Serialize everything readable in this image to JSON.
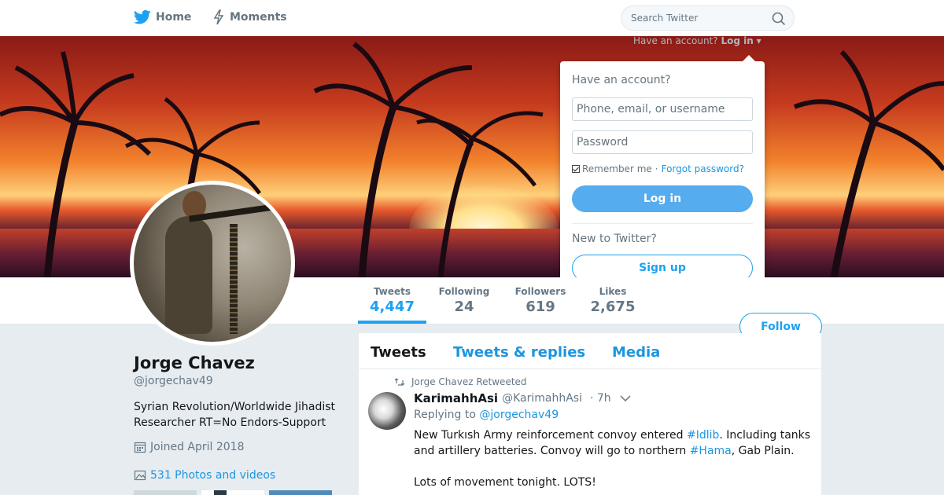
{
  "nav": {
    "home_label": "Home",
    "moments_label": "Moments",
    "search_placeholder": "Search Twitter",
    "signin_hint": "Have an account?",
    "signin_link": "Log in"
  },
  "login_dropdown": {
    "title": "Have an account?",
    "username_placeholder": "Phone, email, or username",
    "password_placeholder": "Password",
    "remember_label": "Remember me",
    "separator": "·",
    "forgot_label": "Forgot password?",
    "login_button": "Log in",
    "new_label": "New to Twitter?",
    "signup_button": "Sign up"
  },
  "stats": [
    {
      "label": "Tweets",
      "value": "4,447"
    },
    {
      "label": "Following",
      "value": "24"
    },
    {
      "label": "Followers",
      "value": "619"
    },
    {
      "label": "Likes",
      "value": "2,675"
    }
  ],
  "follow_button": "Follow",
  "profile": {
    "name": "Jorge Chavez",
    "handle": "@jorgechav49",
    "bio": "Syrian Revolution/Worldwide Jihadist Researcher RT=No Endors-Support",
    "joined": "Joined April 2018",
    "photos": "531 Photos and videos"
  },
  "tabs": [
    "Tweets",
    "Tweets & replies",
    "Media"
  ],
  "tweet": {
    "retweet_line": "Jorge Chavez Retweeted",
    "author_name": "KarimahhAsi",
    "author_handle": "@KarimahhAsi",
    "time": "· 7h",
    "replying_prefix": "Replying to",
    "replying_to": "@jorgechav49",
    "text_1": "New Turkısh Army reinforcement convoy entered ",
    "tag_1": "#Idlib",
    "text_2": ". Including tanks and  artillery batteries. Convoy will go to northern ",
    "tag_2": "#Hama",
    "text_3": ", Gab Plain.",
    "text_4": "Lots of movement tonight. LOTS!"
  },
  "colors": {
    "accent": "#1da1f2",
    "link": "#1b95e0",
    "text": "#14171a",
    "muted": "#657786",
    "background": "#e6ecf0"
  }
}
